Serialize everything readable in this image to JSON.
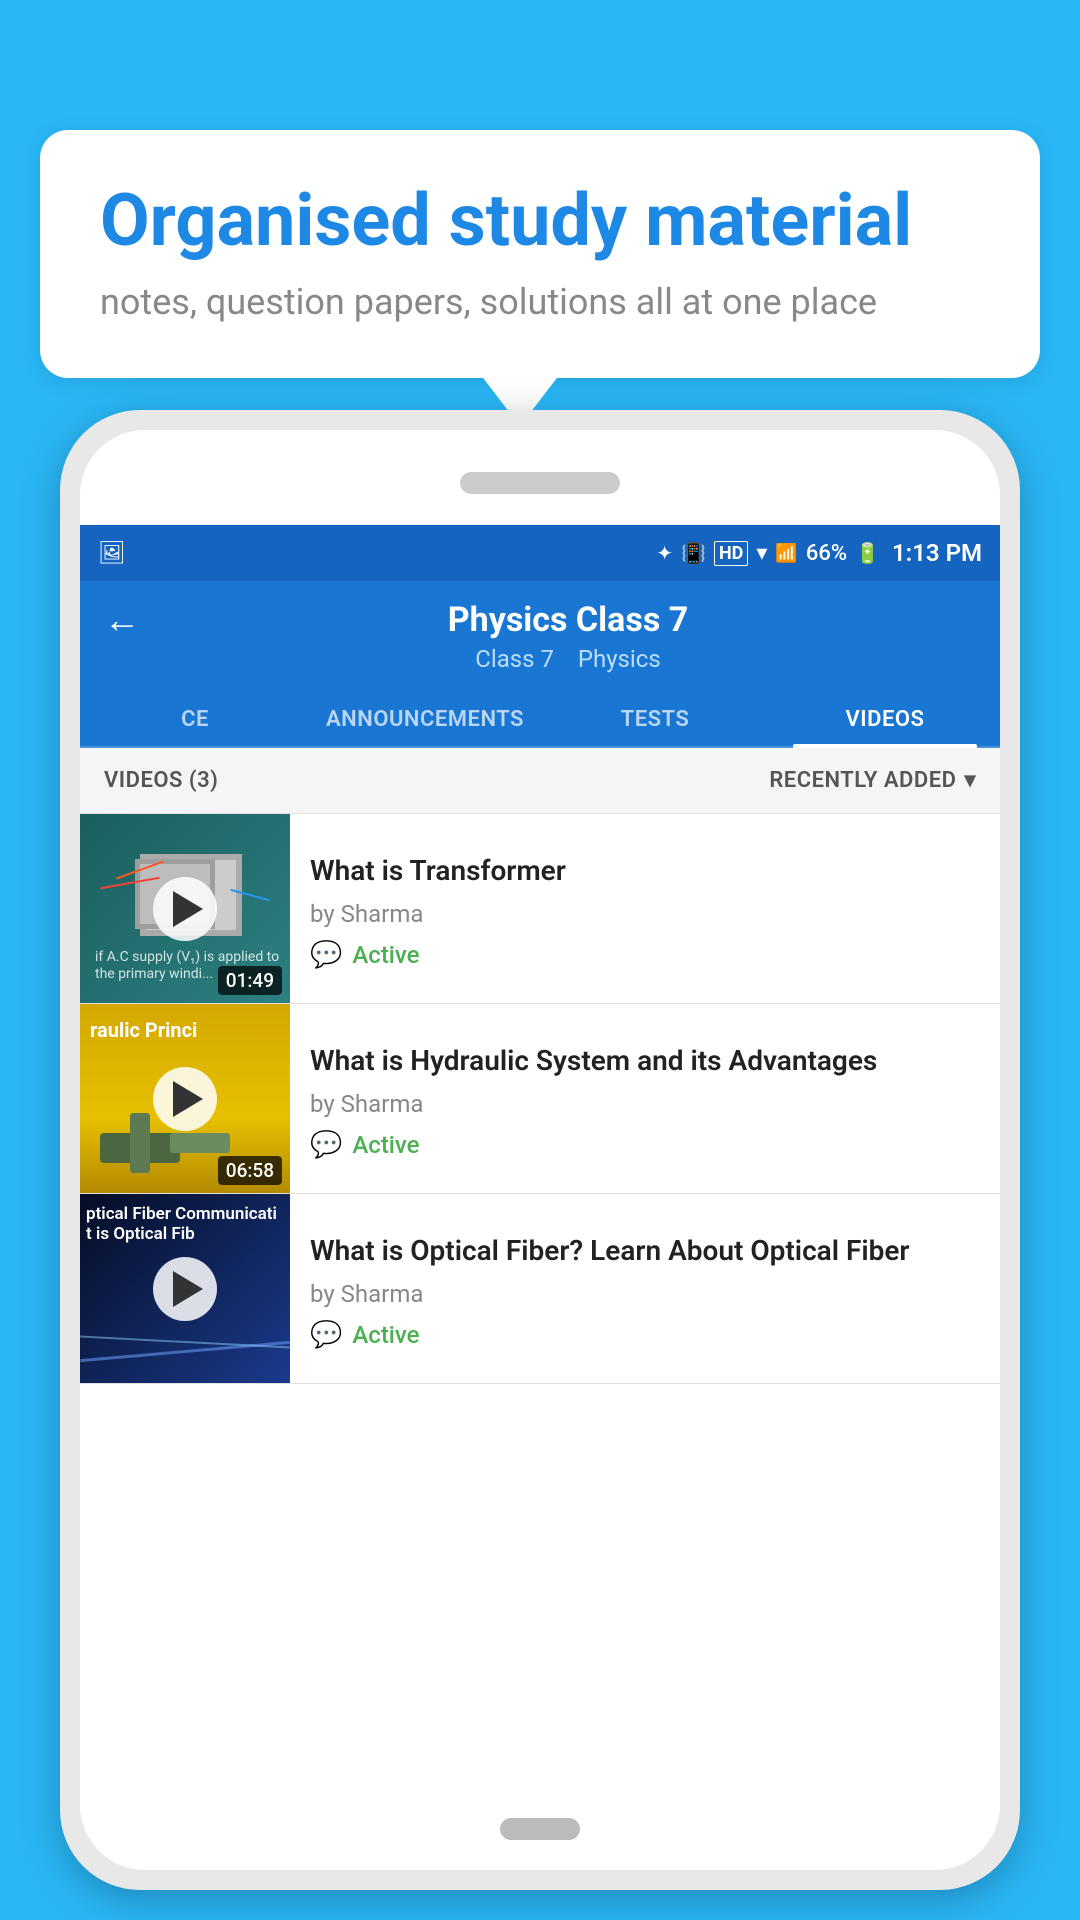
{
  "background": {
    "color": "#29b6f6"
  },
  "speech_bubble": {
    "title": "Organised study material",
    "subtitle": "notes, question papers, solutions all at one place"
  },
  "status_bar": {
    "battery": "66%",
    "time": "1:13 PM",
    "icons": [
      "bluetooth",
      "vibrate",
      "hd",
      "wifi",
      "signal",
      "battery"
    ]
  },
  "app_bar": {
    "back_label": "←",
    "title": "Physics Class 7",
    "subtitle_class": "Class 7",
    "subtitle_subject": "Physics"
  },
  "tabs": [
    {
      "label": "CE",
      "active": false
    },
    {
      "label": "ANNOUNCEMENTS",
      "active": false
    },
    {
      "label": "TESTS",
      "active": false
    },
    {
      "label": "VIDEOS",
      "active": true
    }
  ],
  "videos_header": {
    "count_label": "VIDEOS (3)",
    "sort_label": "RECENTLY ADDED"
  },
  "videos": [
    {
      "title": "What is  Transformer",
      "author": "by Sharma",
      "status": "Active",
      "duration": "01:49",
      "thumb_type": "transformer"
    },
    {
      "title": "What is Hydraulic System and its Advantages",
      "author": "by Sharma",
      "status": "Active",
      "duration": "06:58",
      "thumb_type": "hydraulic",
      "thumb_text": "raulic Princi"
    },
    {
      "title": "What is Optical Fiber? Learn About Optical Fiber",
      "author": "by Sharma",
      "status": "Active",
      "duration": "",
      "thumb_type": "optical",
      "thumb_text": "ptical Fiber Communicati\nt is Optical Fib"
    }
  ]
}
